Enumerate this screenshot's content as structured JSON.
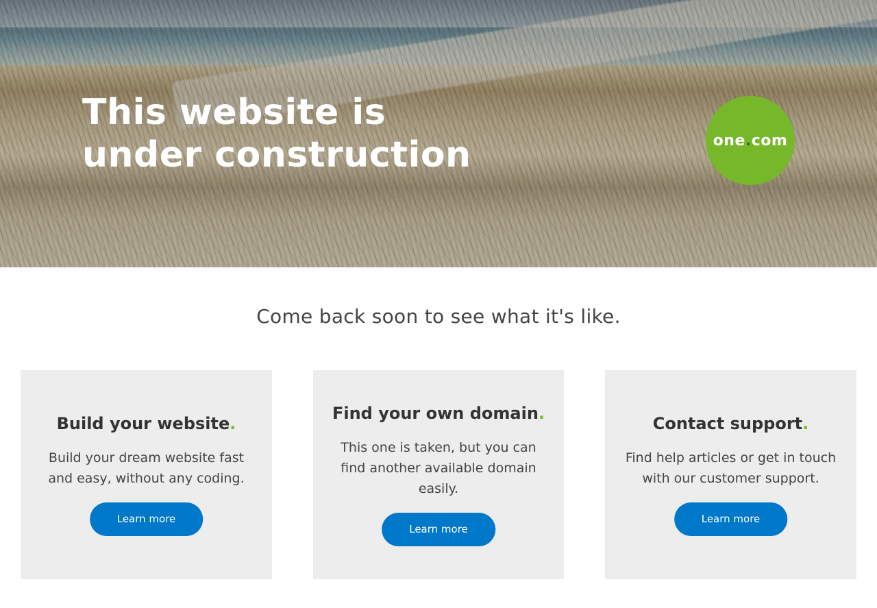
{
  "hero": {
    "title": "This website is under construction",
    "logo": {
      "text_before_dot": "one",
      "dot": ".",
      "text_after_dot": "com",
      "color": "#76b82a"
    }
  },
  "tagline": "Come back soon to see what it's like.",
  "cards": [
    {
      "title": "Build your website",
      "accent": ".",
      "description": "Build your dream website fast and easy, without any coding.",
      "button_label": "Learn more"
    },
    {
      "title": "Find your own domain",
      "accent": ".",
      "description": "This one is taken, but you can find another available domain easily.",
      "button_label": "Learn more"
    },
    {
      "title": "Contact support",
      "accent": ".",
      "description": "Find help articles or get in touch with our customer support.",
      "button_label": "Learn more"
    }
  ],
  "colors": {
    "brand_green": "#76b82a",
    "button_blue": "#0078c9",
    "card_background": "#ededed"
  }
}
